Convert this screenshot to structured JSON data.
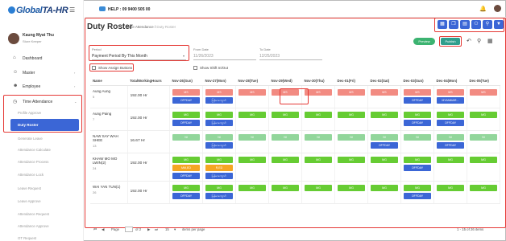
{
  "brand": {
    "name_part1": "Global",
    "name_part2": "TA-HR"
  },
  "user": {
    "name": "Kaung Myat Thu",
    "role": "Store Keeper"
  },
  "nav": [
    {
      "label": "Dashboard",
      "icon": "home-icon"
    },
    {
      "label": "Master",
      "icon": "user-icon"
    },
    {
      "label": "Employee",
      "icon": "users-icon"
    },
    {
      "label": "Time Attendance",
      "icon": "clock-icon"
    }
  ],
  "submenu": [
    "Profile Approve",
    "Duty Roster",
    "Generate Leave",
    "Attendance Calculate",
    "Attendance Process",
    "Attendance Lock",
    "Leave Request",
    "Leave Approve",
    "Attendance Request",
    "Attendance Approve",
    "OT Request"
  ],
  "help": "HELP : 09 9400 505 00",
  "page": {
    "title": "Duty Roster",
    "crumb1": "Time Attendance",
    "crumb2": "Duty Roster"
  },
  "actions": {
    "preview": "Preview",
    "publish": "Publish"
  },
  "filters": {
    "period_label": "Period",
    "period_value": "Payment Period By This Month",
    "from_label": "From Date",
    "from_value": "11/26/2023",
    "to_label": "To Date",
    "to_value": "12/25/2023",
    "assign_buttons": "Show Assign Buttons",
    "shift_inout": "Show Shift In/Out"
  },
  "columns": [
    "Name",
    "TotalWorkingHours",
    "Nov-26(Sun)",
    "Nov-27(Mon)",
    "Nov-28(Tue)",
    "Nov-29(Wed)",
    "Nov-30(Thu)",
    "Dec-01(Fri)",
    "Dec-02(Sat)",
    "Dec-03(Sun)",
    "Dec-04(Mon)",
    "Dec-05(Tue)"
  ],
  "rows": [
    {
      "name": "Aung Aung",
      "id": "5",
      "hours": "192.00 Hr",
      "cells": [
        [
          "MS",
          "OFFDAY"
        ],
        [
          "MS",
          "မြန်မာကျောင်း"
        ],
        [
          "MS"
        ],
        [
          "MS"
        ],
        [
          "MS"
        ],
        [
          "MS"
        ],
        [
          "MS"
        ],
        [
          "MS",
          "OFFDAY"
        ],
        [
          "MS",
          "MYANMAR..."
        ],
        [
          "MS"
        ]
      ]
    },
    {
      "name": "Aung Paing",
      "id": "7",
      "hours": "192.00 Hr",
      "cells": [
        [
          "MG",
          "OFFDAY"
        ],
        [
          "MG",
          "မြန်မာကျောင်း"
        ],
        [
          "MG"
        ],
        [
          "MG"
        ],
        [
          "MG"
        ],
        [
          "MG"
        ],
        [
          "MG"
        ],
        [
          "MG",
          "OFFDAY"
        ],
        [
          "MG",
          "OFFDAY"
        ],
        [
          "MG"
        ]
      ]
    },
    {
      "name": "NAW SAY WAH SHEE",
      "id": "13",
      "hours": "16.67 Hr",
      "cells": [
        [
          "NI"
        ],
        [
          "NI",
          "မြန်မာကျောင်း"
        ],
        [
          "NI"
        ],
        [
          "NI"
        ],
        [
          "NI"
        ],
        [
          "NI"
        ],
        [
          "NI",
          "OFFDAY"
        ],
        [
          "NI"
        ],
        [
          "NI",
          "OFFDAY"
        ],
        [
          "NI"
        ]
      ]
    },
    {
      "name": "KHAW MO MO LWIN(2)",
      "id": "24",
      "hours": "192.00 Hr",
      "cells": [
        [
          "MG",
          "MM,ED",
          "OFFDAY"
        ],
        [
          "MG",
          "R,ED",
          "မြန်မာကျောင်း"
        ],
        [
          "MG"
        ],
        [
          "MG"
        ],
        [
          "MG"
        ],
        [
          "MG"
        ],
        [
          "MG"
        ],
        [
          "MG",
          "OFFDAY"
        ],
        [
          "MG"
        ],
        [
          "MG"
        ]
      ]
    },
    {
      "name": "WAI YAN TUN(1)",
      "id": "26",
      "hours": "192.00 Hr",
      "cells": [
        [
          "MG",
          "OFFDAY"
        ],
        [
          "MG",
          "မြန်မာကျောင်း"
        ],
        [
          "MG"
        ],
        [
          "MG"
        ],
        [
          "MG"
        ],
        [
          "MG"
        ],
        [
          "MG"
        ],
        [
          "MG",
          "OFFDAY"
        ],
        [
          "MG"
        ],
        [
          "MG"
        ]
      ]
    }
  ],
  "pager": {
    "page": "Page",
    "of": "of 2",
    "per": "15",
    "per_label": "items per page",
    "summary": "1 - 15 of 26 items"
  }
}
